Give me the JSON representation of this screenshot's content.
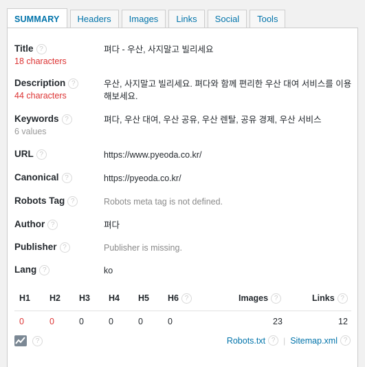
{
  "tabs": [
    "SUMMARY",
    "Headers",
    "Images",
    "Links",
    "Social",
    "Tools"
  ],
  "summary": {
    "title": {
      "label": "Title",
      "sub": "18 characters",
      "value": "펴다 - 우산, 사지말고 빌리세요"
    },
    "description": {
      "label": "Description",
      "sub": "44 characters",
      "value": "우산, 사지말고 빌리세요. 펴다와 함께 편리한 우산 대여 서비스를 이용해보세요."
    },
    "keywords": {
      "label": "Keywords",
      "sub": "6 values",
      "value": "펴다, 우산 대여, 우산 공유, 우산 렌탈, 공유 경제, 우산 서비스"
    },
    "url": {
      "label": "URL",
      "value": "https://www.pyeoda.co.kr/"
    },
    "canonical": {
      "label": "Canonical",
      "value": "https://pyeoda.co.kr/"
    },
    "robots": {
      "label": "Robots Tag",
      "value": "Robots meta tag is not defined."
    },
    "author": {
      "label": "Author",
      "value": "펴다"
    },
    "publisher": {
      "label": "Publisher",
      "value": "Publisher is missing."
    },
    "lang": {
      "label": "Lang",
      "value": "ko"
    }
  },
  "headings": {
    "labels": [
      "H1",
      "H2",
      "H3",
      "H4",
      "H5",
      "H6"
    ],
    "values": [
      "0",
      "0",
      "0",
      "0",
      "0",
      "0"
    ]
  },
  "stats": {
    "images_label": "Images",
    "images_value": "23",
    "links_label": "Links",
    "links_value": "12"
  },
  "footer": {
    "robots_link": "Robots.txt",
    "sitemap_link": "Sitemap.xml"
  },
  "colors": {
    "accent": "#0073aa",
    "error": "#dc3232"
  },
  "icons": {
    "help": "?"
  }
}
